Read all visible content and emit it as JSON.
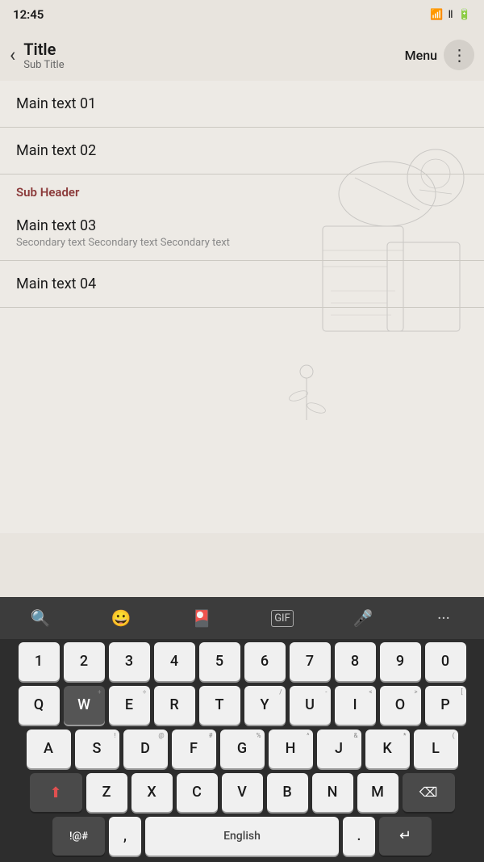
{
  "statusBar": {
    "time": "12:45",
    "wifi": "wifi",
    "signal": "signal",
    "battery": "battery"
  },
  "appBar": {
    "backLabel": "‹",
    "title": "Title",
    "subtitle": "Sub Title",
    "menuLabel": "Menu",
    "moreIcon": "⋮"
  },
  "listItems": [
    {
      "id": "item1",
      "text": "Main text 01",
      "secondary": null
    },
    {
      "id": "item2",
      "text": "Main text 02",
      "secondary": null
    }
  ],
  "subHeader": {
    "text": "Sub Header"
  },
  "listItemsBottom": [
    {
      "id": "item3",
      "text": "Main text 03",
      "secondary": "Secondary text Secondary text Secondary text"
    },
    {
      "id": "item4",
      "text": "Main text 04",
      "secondary": null
    }
  ],
  "keyboard": {
    "toolbarButtons": [
      "🔍",
      "🙂",
      "🎴",
      "GIF",
      "🎤",
      "···"
    ],
    "rows": {
      "numbers": [
        "1",
        "2",
        "3",
        "4",
        "5",
        "6",
        "7",
        "8",
        "9",
        "0"
      ],
      "qwerty": [
        {
          "label": "Q",
          "sub": ""
        },
        {
          "label": "W",
          "sub": "+",
          "active": true
        },
        {
          "label": "E",
          "sub": "÷"
        },
        {
          "label": "R",
          "sub": ""
        },
        {
          "label": "T",
          "sub": ""
        },
        {
          "label": "Y",
          "sub": "/"
        },
        {
          "label": "U",
          "sub": "-"
        },
        {
          "label": "I",
          "sub": "<"
        },
        {
          "label": "O",
          "sub": ">"
        },
        {
          "label": "P",
          "sub": "["
        }
      ],
      "asdf": [
        {
          "label": "A",
          "sub": ""
        },
        {
          "label": "S",
          "sub": "!"
        },
        {
          "label": "D",
          "sub": "@"
        },
        {
          "label": "F",
          "sub": "#"
        },
        {
          "label": "G",
          "sub": "%"
        },
        {
          "label": "H",
          "sub": "^"
        },
        {
          "label": "J",
          "sub": "&"
        },
        {
          "label": "K",
          "sub": "*"
        },
        {
          "label": "L",
          "sub": "("
        }
      ],
      "zxcv": [
        "Z",
        "X",
        "C",
        "V",
        "B",
        "N",
        "M"
      ],
      "space": {
        "special": "!@#",
        "comma": ",",
        "spaceLabel": "English",
        "period": ".",
        "enterIcon": "↵"
      }
    }
  }
}
